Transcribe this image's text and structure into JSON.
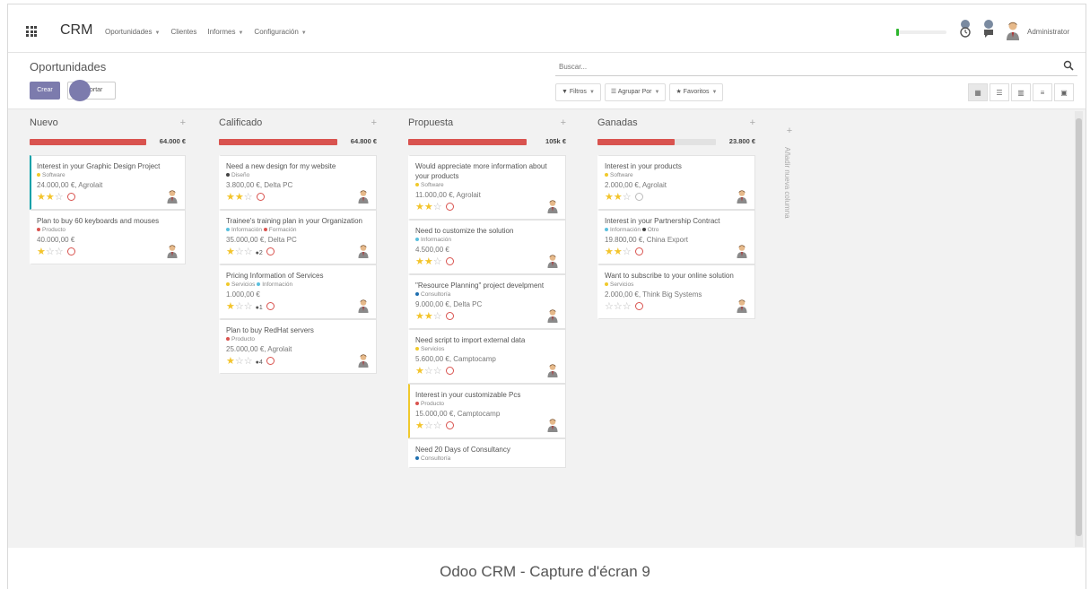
{
  "navbar": {
    "brand": "CRM",
    "menu": [
      {
        "label": "Oportunidades",
        "dropdown": true
      },
      {
        "label": "Clientes",
        "dropdown": false
      },
      {
        "label": "Informes",
        "dropdown": true
      },
      {
        "label": "Configuración",
        "dropdown": true
      }
    ],
    "user": "Administrator",
    "icons": [
      "apps-grid-icon",
      "activity-clock-icon",
      "messages-icon",
      "user-avatar-icon"
    ]
  },
  "control_panel": {
    "title": "Oportunidades",
    "create_label": "Crear",
    "import_label": "ortar",
    "search_placeholder": "Buscar...",
    "filters_label": "Filtros",
    "group_label": "Agrupar Por",
    "favorites_label": "Favoritos",
    "views": [
      "kanban-view-icon",
      "list-view-icon",
      "graph-view-icon",
      "pivot-view-icon",
      "calendar-view-icon"
    ]
  },
  "kanban": {
    "add_column_label": "Añadir nueva columna",
    "columns": [
      {
        "title": "Nuevo",
        "total": "64.000 €",
        "progress": 1.0,
        "cards": [
          {
            "title": "Interest in your Graphic Design Project",
            "tags": [
              {
                "label": "Software",
                "color": "#f0c92b"
              }
            ],
            "amount": "24.000,00 €, Agrolait",
            "stars": 2,
            "messages": "",
            "activity": "red",
            "accent": "green"
          },
          {
            "title": "Plan to buy 60 keyboards and mouses",
            "tags": [
              {
                "label": "Producto",
                "color": "#d9534f"
              }
            ],
            "amount": "40.000,00 €",
            "stars": 1,
            "messages": "",
            "activity": "red",
            "accent": ""
          }
        ]
      },
      {
        "title": "Calificado",
        "total": "64.800 €",
        "progress": 1.0,
        "cards": [
          {
            "title": "Need a new design for my website",
            "tags": [
              {
                "label": "Diseño",
                "color": "#444444"
              }
            ],
            "amount": "3.800,00 €, Delta PC",
            "stars": 2,
            "messages": "",
            "activity": "red",
            "accent": ""
          },
          {
            "title": "Trainee's training plan in your Organization",
            "tags": [
              {
                "label": "Información",
                "color": "#5bc0de"
              },
              {
                "label": "Formación",
                "color": "#d9534f"
              }
            ],
            "amount": "35.000,00 €, Delta PC",
            "stars": 1,
            "messages": "2",
            "activity": "red",
            "accent": ""
          },
          {
            "title": "Pricing Information of Services",
            "tags": [
              {
                "label": "Servicios",
                "color": "#f0c92b"
              },
              {
                "label": "Información",
                "color": "#5bc0de"
              }
            ],
            "amount": "1.000,00 €",
            "stars": 1,
            "messages": "1",
            "activity": "red",
            "accent": ""
          },
          {
            "title": "Plan to buy RedHat servers",
            "tags": [
              {
                "label": "Producto",
                "color": "#d9534f"
              }
            ],
            "amount": "25.000,00 €, Agrolait",
            "stars": 1,
            "messages": "4",
            "activity": "red",
            "accent": ""
          }
        ]
      },
      {
        "title": "Propuesta",
        "total": "105k €",
        "progress": 1.0,
        "cards": [
          {
            "title": "Would appreciate more information about your products",
            "tags": [
              {
                "label": "Software",
                "color": "#f0c92b"
              }
            ],
            "amount": "11.000,00 €, Agrolait",
            "stars": 2,
            "messages": "",
            "activity": "red",
            "accent": ""
          },
          {
            "title": "Need to customize the solution",
            "tags": [
              {
                "label": "Información",
                "color": "#5bc0de"
              }
            ],
            "amount": "4.500,00 €",
            "stars": 2,
            "messages": "",
            "activity": "red",
            "accent": ""
          },
          {
            "title": "\"Resource Planning\" project develpment",
            "tags": [
              {
                "label": "Consultoría",
                "color": "#1f6fb0"
              }
            ],
            "amount": "9.000,00 €, Delta PC",
            "stars": 2,
            "messages": "",
            "activity": "red",
            "accent": ""
          },
          {
            "title": "Need script to import external data",
            "tags": [
              {
                "label": "Servicios",
                "color": "#f0c92b"
              }
            ],
            "amount": "5.600,00 €, Camptocamp",
            "stars": 1,
            "messages": "",
            "activity": "red",
            "accent": ""
          },
          {
            "title": "Interest in your customizable Pcs",
            "tags": [
              {
                "label": "Producto",
                "color": "#d9534f"
              }
            ],
            "amount": "15.000,00 €, Camptocamp",
            "stars": 1,
            "messages": "",
            "activity": "red",
            "accent": "yellow"
          },
          {
            "title": "Need 20 Days of Consultancy",
            "tags": [
              {
                "label": "Consultoría",
                "color": "#1f6fb0"
              }
            ],
            "amount": "",
            "stars": -1,
            "messages": "",
            "activity": "",
            "accent": ""
          }
        ]
      },
      {
        "title": "Ganadas",
        "total": "23.800 €",
        "progress": 0.65,
        "cards": [
          {
            "title": "Interest in your products",
            "tags": [
              {
                "label": "Software",
                "color": "#f0c92b"
              }
            ],
            "amount": "2.000,00 €, Agrolait",
            "stars": 2,
            "messages": "",
            "activity": "grey",
            "accent": ""
          },
          {
            "title": "Interest in your Partnership Contract",
            "tags": [
              {
                "label": "Información",
                "color": "#5bc0de"
              },
              {
                "label": "Otro",
                "color": "#444444"
              }
            ],
            "amount": "19.800,00 €, China Export",
            "stars": 2,
            "messages": "",
            "activity": "red",
            "accent": ""
          },
          {
            "title": "Want to subscribe to your online solution",
            "tags": [
              {
                "label": "Servicios",
                "color": "#f0c92b"
              }
            ],
            "amount": "2.000,00 €, Think Big Systems",
            "stars": 0,
            "messages": "",
            "activity": "red",
            "accent": ""
          }
        ]
      }
    ]
  },
  "caption": "Odoo CRM - Capture d'écran 9"
}
